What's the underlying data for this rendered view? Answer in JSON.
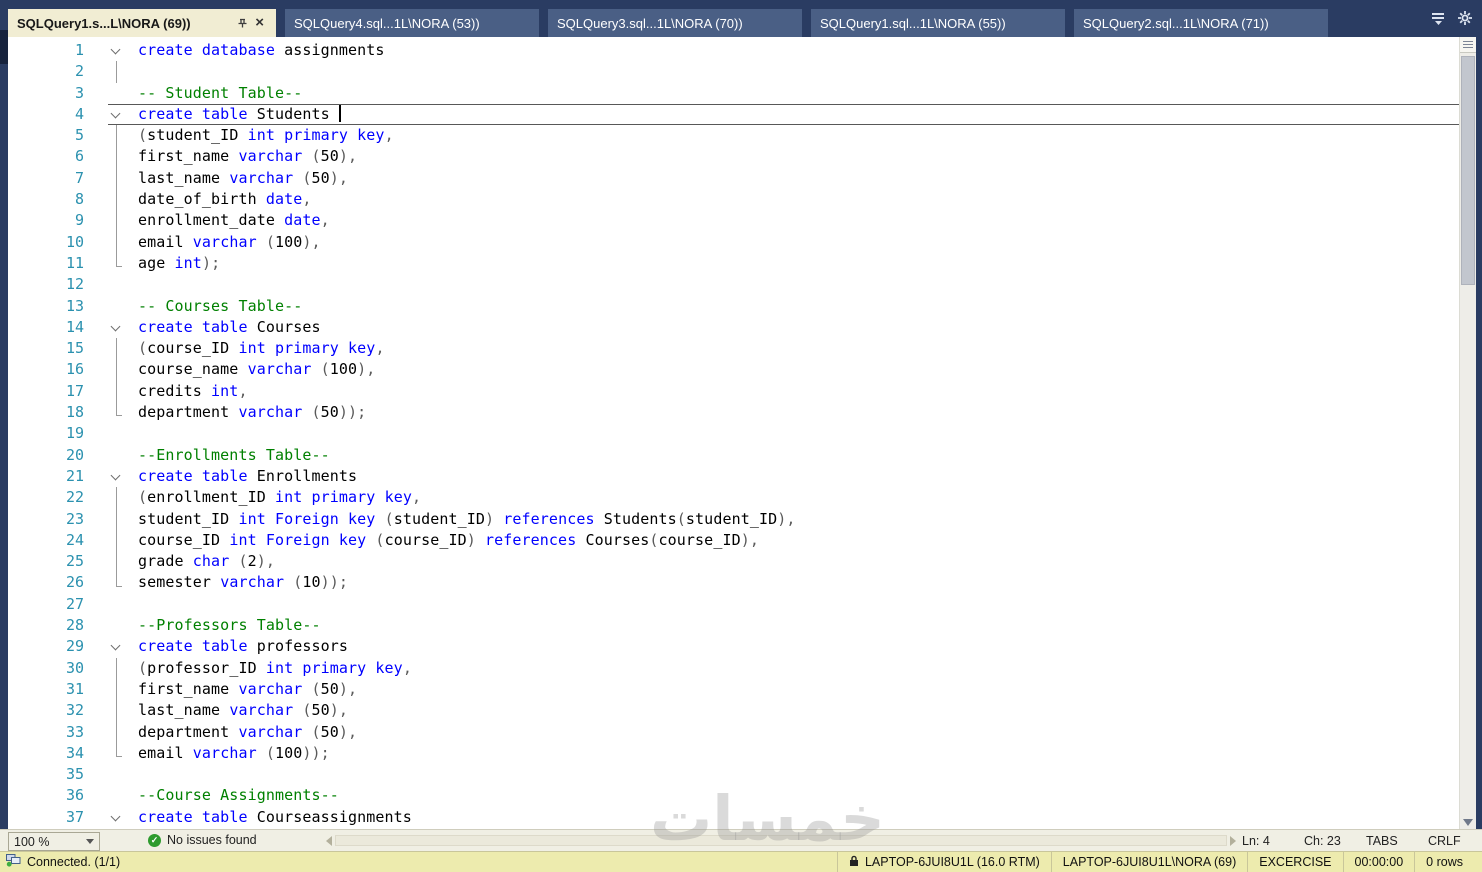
{
  "colors": {
    "keyword": "#0000FF",
    "comment": "#008000",
    "identifier": "#000000",
    "punctuation": "#5A5A5A",
    "line_number": "#2B91AF",
    "topbar_bg": "#2A3C62",
    "tab_inactive_bg": "#4A5F85",
    "tab_active_bg": "#F1EDD3",
    "status_bar_bg": "#F0EFE4",
    "connection_bar_bg": "#EDEBAE",
    "current_line_border": "#585858"
  },
  "icons": {
    "tab_bar_right": [
      "document-list-dropdown-icon",
      "settings-gear-icon"
    ],
    "active_tab": [
      "pin-icon",
      "close-icon"
    ],
    "status": [
      "check-circle-icon"
    ],
    "connection": [
      "connection-status-icon",
      "lock-icon"
    ],
    "scrollbar": [
      "splitter-grip-icon",
      "scroll-down-arrow-icon"
    ]
  },
  "tabs": [
    {
      "label": "SQLQuery1.s...L\\NORA (69))",
      "active": true
    },
    {
      "label": "SQLQuery4.sql...1L\\NORA (53))",
      "active": false
    },
    {
      "label": "SQLQuery3.sql...1L\\NORA (70))",
      "active": false
    },
    {
      "label": "SQLQuery1.sql...1L\\NORA (55))",
      "active": false
    },
    {
      "label": "SQLQuery2.sql...1L\\NORA (71))",
      "active": false
    }
  ],
  "editor": {
    "lines": [
      {
        "n": 1,
        "fold": "start",
        "tokens": [
          [
            "k",
            "create "
          ],
          [
            "k",
            "database "
          ],
          [
            "i",
            "assignments"
          ]
        ]
      },
      {
        "n": 2,
        "fold": "mid",
        "tokens": []
      },
      {
        "n": 3,
        "tokens": [
          [
            "c",
            "-- Student Table--"
          ]
        ]
      },
      {
        "n": 4,
        "fold": "start",
        "current": true,
        "caret": true,
        "tokens": [
          [
            "k",
            "create "
          ],
          [
            "k",
            "table "
          ],
          [
            "i",
            "Students "
          ]
        ]
      },
      {
        "n": 5,
        "fold": "mid",
        "tokens": [
          [
            "p",
            "("
          ],
          [
            "i",
            "student_ID "
          ],
          [
            "k",
            "int "
          ],
          [
            "k",
            "primary "
          ],
          [
            "k",
            "key"
          ],
          [
            "p",
            ","
          ]
        ]
      },
      {
        "n": 6,
        "fold": "mid",
        "tokens": [
          [
            "i",
            "first_name "
          ],
          [
            "k",
            "varchar "
          ],
          [
            "p",
            "("
          ],
          [
            "n",
            "50"
          ],
          [
            "p",
            "),"
          ]
        ]
      },
      {
        "n": 7,
        "fold": "mid",
        "tokens": [
          [
            "i",
            "last_name "
          ],
          [
            "k",
            "varchar "
          ],
          [
            "p",
            "("
          ],
          [
            "n",
            "50"
          ],
          [
            "p",
            "),"
          ]
        ]
      },
      {
        "n": 8,
        "fold": "mid",
        "tokens": [
          [
            "i",
            "date_of_birth "
          ],
          [
            "k",
            "date"
          ],
          [
            "p",
            ","
          ]
        ]
      },
      {
        "n": 9,
        "fold": "mid",
        "tokens": [
          [
            "i",
            "enrollment_date "
          ],
          [
            "k",
            "date"
          ],
          [
            "p",
            ","
          ]
        ]
      },
      {
        "n": 10,
        "fold": "mid",
        "tokens": [
          [
            "i",
            "email "
          ],
          [
            "k",
            "varchar "
          ],
          [
            "p",
            "("
          ],
          [
            "n",
            "100"
          ],
          [
            "p",
            "),"
          ]
        ]
      },
      {
        "n": 11,
        "fold": "end",
        "tokens": [
          [
            "i",
            "age "
          ],
          [
            "k",
            "int"
          ],
          [
            "p",
            ");"
          ]
        ]
      },
      {
        "n": 12,
        "tokens": []
      },
      {
        "n": 13,
        "tokens": [
          [
            "c",
            "-- Courses Table--"
          ]
        ]
      },
      {
        "n": 14,
        "fold": "start",
        "tokens": [
          [
            "k",
            "create "
          ],
          [
            "k",
            "table "
          ],
          [
            "i",
            "Courses"
          ]
        ]
      },
      {
        "n": 15,
        "fold": "mid",
        "tokens": [
          [
            "p",
            "("
          ],
          [
            "i",
            "course_ID "
          ],
          [
            "k",
            "int "
          ],
          [
            "k",
            "primary "
          ],
          [
            "k",
            "key"
          ],
          [
            "p",
            ","
          ]
        ]
      },
      {
        "n": 16,
        "fold": "mid",
        "tokens": [
          [
            "i",
            "course_name "
          ],
          [
            "k",
            "varchar "
          ],
          [
            "p",
            "("
          ],
          [
            "n",
            "100"
          ],
          [
            "p",
            "),"
          ]
        ]
      },
      {
        "n": 17,
        "fold": "mid",
        "tokens": [
          [
            "i",
            "credits "
          ],
          [
            "k",
            "int"
          ],
          [
            "p",
            ","
          ]
        ]
      },
      {
        "n": 18,
        "fold": "end",
        "tokens": [
          [
            "i",
            "department "
          ],
          [
            "k",
            "varchar "
          ],
          [
            "p",
            "("
          ],
          [
            "n",
            "50"
          ],
          [
            "p",
            "));"
          ]
        ]
      },
      {
        "n": 19,
        "tokens": []
      },
      {
        "n": 20,
        "tokens": [
          [
            "c",
            "--Enrollments Table--"
          ]
        ]
      },
      {
        "n": 21,
        "fold": "start",
        "tokens": [
          [
            "k",
            "create "
          ],
          [
            "k",
            "table "
          ],
          [
            "i",
            "Enrollments"
          ]
        ]
      },
      {
        "n": 22,
        "fold": "mid",
        "tokens": [
          [
            "p",
            "("
          ],
          [
            "i",
            "enrollment_ID "
          ],
          [
            "k",
            "int "
          ],
          [
            "k",
            "primary "
          ],
          [
            "k",
            "key"
          ],
          [
            "p",
            ","
          ]
        ]
      },
      {
        "n": 23,
        "fold": "mid",
        "tokens": [
          [
            "i",
            "student_ID "
          ],
          [
            "k",
            "int "
          ],
          [
            "k",
            "Foreign "
          ],
          [
            "k",
            "key "
          ],
          [
            "p",
            "("
          ],
          [
            "i",
            "student_ID"
          ],
          [
            "p",
            ") "
          ],
          [
            "k",
            "references "
          ],
          [
            "i",
            "Students"
          ],
          [
            "p",
            "("
          ],
          [
            "i",
            "student_ID"
          ],
          [
            "p",
            "),"
          ]
        ]
      },
      {
        "n": 24,
        "fold": "mid",
        "tokens": [
          [
            "i",
            "course_ID "
          ],
          [
            "k",
            "int "
          ],
          [
            "k",
            "Foreign "
          ],
          [
            "k",
            "key "
          ],
          [
            "p",
            "("
          ],
          [
            "i",
            "course_ID"
          ],
          [
            "p",
            ") "
          ],
          [
            "k",
            "references "
          ],
          [
            "i",
            "Courses"
          ],
          [
            "p",
            "("
          ],
          [
            "i",
            "course_ID"
          ],
          [
            "p",
            "),"
          ]
        ]
      },
      {
        "n": 25,
        "fold": "mid",
        "tokens": [
          [
            "i",
            "grade "
          ],
          [
            "k",
            "char "
          ],
          [
            "p",
            "("
          ],
          [
            "n",
            "2"
          ],
          [
            "p",
            "),"
          ]
        ]
      },
      {
        "n": 26,
        "fold": "end",
        "tokens": [
          [
            "i",
            "semester "
          ],
          [
            "k",
            "varchar "
          ],
          [
            "p",
            "("
          ],
          [
            "n",
            "10"
          ],
          [
            "p",
            "));"
          ]
        ]
      },
      {
        "n": 27,
        "tokens": []
      },
      {
        "n": 28,
        "tokens": [
          [
            "c",
            "--Professors Table--"
          ]
        ]
      },
      {
        "n": 29,
        "fold": "start",
        "tokens": [
          [
            "k",
            "create "
          ],
          [
            "k",
            "table "
          ],
          [
            "i",
            "professors"
          ]
        ]
      },
      {
        "n": 30,
        "fold": "mid",
        "tokens": [
          [
            "p",
            "("
          ],
          [
            "i",
            "professor_ID "
          ],
          [
            "k",
            "int "
          ],
          [
            "k",
            "primary "
          ],
          [
            "k",
            "key"
          ],
          [
            "p",
            ","
          ]
        ]
      },
      {
        "n": 31,
        "fold": "mid",
        "tokens": [
          [
            "i",
            "first_name "
          ],
          [
            "k",
            "varchar "
          ],
          [
            "p",
            "("
          ],
          [
            "n",
            "50"
          ],
          [
            "p",
            "),"
          ]
        ]
      },
      {
        "n": 32,
        "fold": "mid",
        "tokens": [
          [
            "i",
            "last_name "
          ],
          [
            "k",
            "varchar "
          ],
          [
            "p",
            "("
          ],
          [
            "n",
            "50"
          ],
          [
            "p",
            "),"
          ]
        ]
      },
      {
        "n": 33,
        "fold": "mid",
        "tokens": [
          [
            "i",
            "department "
          ],
          [
            "k",
            "varchar "
          ],
          [
            "p",
            "("
          ],
          [
            "n",
            "50"
          ],
          [
            "p",
            "),"
          ]
        ]
      },
      {
        "n": 34,
        "fold": "end",
        "tokens": [
          [
            "i",
            "email "
          ],
          [
            "k",
            "varchar "
          ],
          [
            "p",
            "("
          ],
          [
            "n",
            "100"
          ],
          [
            "p",
            "));"
          ]
        ]
      },
      {
        "n": 35,
        "tokens": []
      },
      {
        "n": 36,
        "tokens": [
          [
            "c",
            "--Course Assignments--"
          ]
        ]
      },
      {
        "n": 37,
        "fold": "start",
        "tokens": [
          [
            "k",
            "create "
          ],
          [
            "k",
            "table "
          ],
          [
            "i",
            "Courseassignments"
          ]
        ]
      }
    ]
  },
  "status": {
    "zoom": "100 %",
    "no_issues": "No issues found",
    "right": [
      {
        "name": "line-indicator",
        "label": "Ln: 4"
      },
      {
        "name": "column-indicator",
        "label": "Ch: 23"
      },
      {
        "name": "indent-indicator",
        "label": "TABS"
      },
      {
        "name": "eol-indicator",
        "label": "CRLF"
      }
    ]
  },
  "conn": {
    "connected": "Connected. (1/1)",
    "items": [
      {
        "name": "server-version",
        "label": "LAPTOP-6JUI8U1L (16.0 RTM)",
        "lock": true
      },
      {
        "name": "login-name",
        "label": "LAPTOP-6JUI8U1L\\NORA (69)"
      },
      {
        "name": "database-name",
        "label": "EXCERCISE"
      },
      {
        "name": "query-elapsed-time",
        "label": "00:00:00"
      },
      {
        "name": "row-count",
        "label": "0 rows"
      }
    ]
  },
  "watermark": "خمسات"
}
